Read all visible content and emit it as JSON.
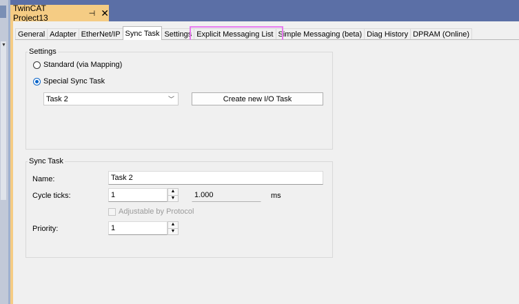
{
  "document_tab": {
    "title": "TwinCAT Project13",
    "pin_icon": "pin-icon",
    "close_icon": "close-icon"
  },
  "tabs": [
    {
      "label": "General"
    },
    {
      "label": "Adapter"
    },
    {
      "label": "EtherNet/IP"
    },
    {
      "label": "Sync Task",
      "active": true
    },
    {
      "label": "Settings"
    },
    {
      "label": "Explicit Messaging List"
    },
    {
      "label": "Simple Messaging (beta)"
    },
    {
      "label": "Diag History"
    },
    {
      "label": "DPRAM (Online)"
    }
  ],
  "settings": {
    "legend": "Settings",
    "radio_standard": "Standard (via Mapping)",
    "radio_special": "Special Sync Task",
    "selected": "special",
    "task_select_value": "Task 2",
    "create_button": "Create new I/O Task"
  },
  "sync_task": {
    "legend": "Sync Task",
    "name_label": "Name:",
    "name_value": "Task 2",
    "cycle_label": "Cycle ticks:",
    "cycle_value": "1",
    "cycle_time_value": "1.000",
    "cycle_unit": "ms",
    "adjustable_label": "Adjustable by Protocol",
    "priority_label": "Priority:",
    "priority_value": "1"
  },
  "colors": {
    "doc_tab_bg": "#f5cc84",
    "header_bg": "#5b6fa6",
    "highlight": "#e77bef",
    "radio_on": "#0a64c8"
  }
}
